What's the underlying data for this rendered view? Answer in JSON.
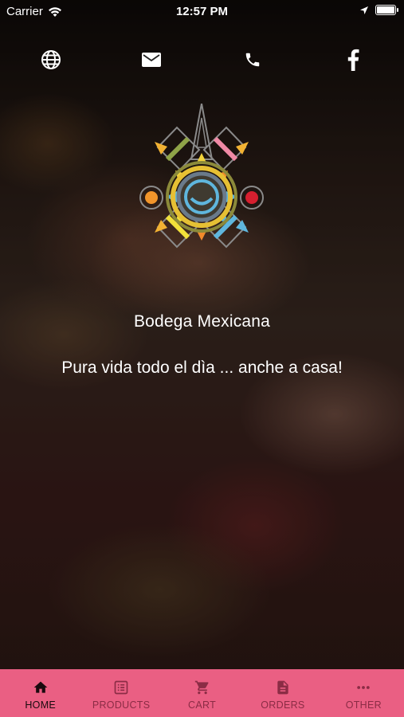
{
  "status_bar": {
    "carrier": "Carrier",
    "time": "12:57 PM"
  },
  "contact_icons": [
    "globe-icon",
    "mail-icon",
    "phone-icon",
    "facebook-icon"
  ],
  "title": "Bodega Mexicana",
  "tagline": "Pura vida todo el dìa ... anche a casa!",
  "tabbar": {
    "accent": "#ea5f83",
    "tabs": [
      {
        "label": "HOME",
        "icon": "home-icon",
        "active": true
      },
      {
        "label": "PRODUCTS",
        "icon": "list-icon",
        "active": false
      },
      {
        "label": "CART",
        "icon": "cart-icon",
        "active": false
      },
      {
        "label": "ORDERS",
        "icon": "document-icon",
        "active": false
      },
      {
        "label": "OTHER",
        "icon": "more-icon",
        "active": false
      }
    ]
  }
}
